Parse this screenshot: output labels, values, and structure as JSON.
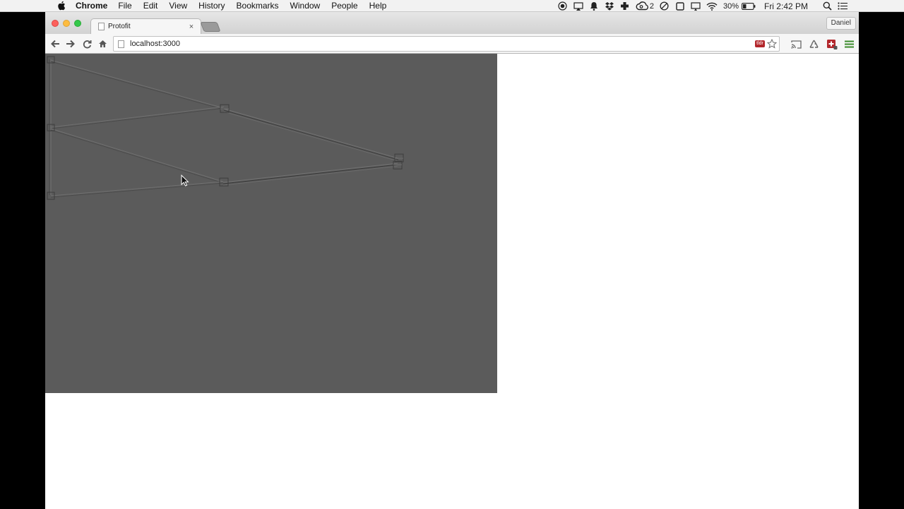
{
  "menubar": {
    "app_name": "Chrome",
    "items": [
      "File",
      "Edit",
      "View",
      "History",
      "Bookmarks",
      "Window",
      "People",
      "Help"
    ],
    "status": {
      "cc_badge": "2",
      "battery": "30%",
      "clock": "Fri 2:42 PM"
    }
  },
  "browser": {
    "tab": {
      "title": "Protofit",
      "close_glyph": "×"
    },
    "profile_name": "Daniel",
    "url": "localhost:3000",
    "tldr_badge": "tldr"
  },
  "colors": {
    "canvas_bg": "#5b5b5b",
    "wire": "#6e6e6e",
    "wire_dark": "#3d3d3d"
  }
}
